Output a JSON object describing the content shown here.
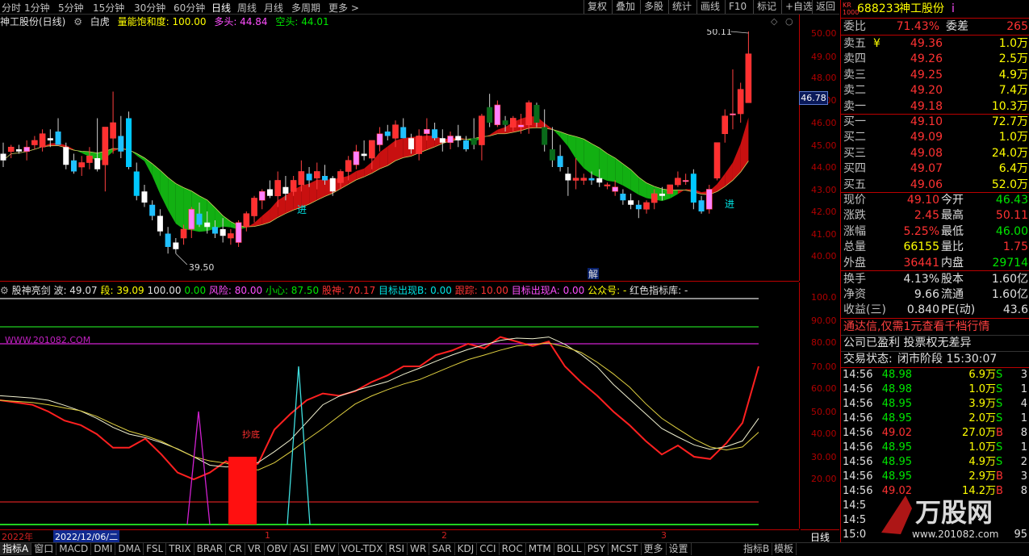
{
  "toolbar": {
    "periods": [
      "分时",
      "1分钟",
      "5分钟",
      "15分钟",
      "30分钟",
      "60分钟",
      "日线",
      "周线",
      "月线",
      "多周期",
      "更多 >"
    ],
    "active_period": "日线",
    "right_buttons": [
      "复权",
      "叠加",
      "多股",
      "统计",
      "画线",
      "F10",
      "标记",
      "+自选",
      "返回"
    ]
  },
  "price_header": {
    "name": "神工股份(日线)",
    "indicator": "白虎",
    "saturation_label": "量能饱和度: 100.00",
    "long_label": "多头: 44.84",
    "short_label": "空头: 44.01"
  },
  "price_axis": {
    "labels": [
      "50.00",
      "49.00",
      "48.00",
      "47.00",
      "46.00",
      "45.00",
      "44.00",
      "43.00",
      "42.00",
      "41.00",
      "40.00"
    ],
    "current": "46.78",
    "high_mark": "50.11",
    "low_mark": "39.50",
    "buy_marks": [
      "进",
      "进"
    ]
  },
  "indicator_header": {
    "name": "股神亮剑",
    "values": [
      "波: 49.07",
      "段: 39.09",
      "100.00",
      "0.00",
      "风险: 80.00",
      "小心: 87.50",
      "股神: 70.17",
      "目标出现B: 0.00",
      "跟踪: 10.00",
      "目标出现A: 0.00",
      "公众号: -",
      "红色指标库: -"
    ],
    "watermark": "WWW.201082.COM",
    "bottom_label": "抄底",
    "solve_label": "解"
  },
  "ind_axis": {
    "labels": [
      "100.0",
      "90.00",
      "80.00",
      "70.00",
      "60.00",
      "50.00",
      "40.00",
      "30.00",
      "20.00"
    ]
  },
  "date_bar": {
    "year": "2022年",
    "selected_date": "2022/12/06/二",
    "months": [
      "1",
      "2",
      "3"
    ]
  },
  "bottom_tabs": {
    "items": [
      "指标A",
      "窗口",
      "MACD",
      "DMI",
      "DMA",
      "FSL",
      "TRIX",
      "BRAR",
      "CR",
      "VR",
      "OBV",
      "ASI",
      "EMV",
      "VOL-TDX",
      "RSI",
      "WR",
      "SAR",
      "KDJ",
      "CCI",
      "ROC",
      "MTM",
      "BOLL",
      "PSY",
      "MCST",
      "更多",
      "设置"
    ],
    "right_items": [
      "指标B",
      "模板"
    ],
    "period_btn": "日线"
  },
  "quote": {
    "tag": "KR 1000",
    "code": "688233",
    "name": "神工股份",
    "info_icon": "i",
    "weibi_label": "委比",
    "weibi": "71.43%",
    "weicha_label": "委差",
    "weicha": "265",
    "asks": [
      {
        "label": "卖五",
        "price": "49.36",
        "vol": "1.0万",
        "flag": "¥"
      },
      {
        "label": "卖四",
        "price": "49.26",
        "vol": "2.5万"
      },
      {
        "label": "卖三",
        "price": "49.25",
        "vol": "4.9万"
      },
      {
        "label": "卖二",
        "price": "49.20",
        "vol": "7.4万"
      },
      {
        "label": "卖一",
        "price": "49.18",
        "vol": "10.3万"
      }
    ],
    "bids": [
      {
        "label": "买一",
        "price": "49.10",
        "vol": "72.7万"
      },
      {
        "label": "买二",
        "price": "49.09",
        "vol": "1.0万"
      },
      {
        "label": "买三",
        "price": "49.08",
        "vol": "24.0万"
      },
      {
        "label": "买四",
        "price": "49.07",
        "vol": "6.4万"
      },
      {
        "label": "买五",
        "price": "49.06",
        "vol": "52.0万"
      }
    ],
    "stats": [
      {
        "l1": "现价",
        "v1": "49.10",
        "c1": "red",
        "l2": "今开",
        "v2": "46.43",
        "c2": "green"
      },
      {
        "l1": "涨跌",
        "v1": "2.45",
        "c1": "red",
        "l2": "最高",
        "v2": "50.11",
        "c2": "red"
      },
      {
        "l1": "涨幅",
        "v1": "5.25%",
        "c1": "red",
        "l2": "最低",
        "v2": "46.00",
        "c2": "green"
      },
      {
        "l1": "总量",
        "v1": "66155",
        "c1": "yellow",
        "l2": "量比",
        "v2": "1.75",
        "c2": "red"
      },
      {
        "l1": "外盘",
        "v1": "36441",
        "c1": "red",
        "l2": "内盘",
        "v2": "29714",
        "c2": "green"
      }
    ],
    "fund": [
      {
        "l1": "换手",
        "v1": "4.13%",
        "l2": "股本",
        "v2": "1.60亿"
      },
      {
        "l1": "净资",
        "v1": "9.66",
        "l2": "流通",
        "v2": "1.60亿"
      },
      {
        "l1": "收益(三)",
        "v1": "0.840",
        "l2": "PE(动)",
        "v2": "43.6"
      }
    ],
    "promo": "通达信,仅需1元查看千档行情",
    "notice": "公司已盈利 投票权无差异",
    "trade_state_label": "交易状态:",
    "trade_state": "闭市阶段 15:30:07"
  },
  "ticks": [
    {
      "t": "14:56",
      "p": "48.98",
      "v": "6.9万",
      "s": "S",
      "n": "3"
    },
    {
      "t": "14:56",
      "p": "48.98",
      "v": "1.0万",
      "s": "S",
      "n": "1"
    },
    {
      "t": "14:56",
      "p": "48.95",
      "v": "3.9万",
      "s": "S",
      "n": "4"
    },
    {
      "t": "14:56",
      "p": "48.95",
      "v": "2.0万",
      "s": "S",
      "n": "1"
    },
    {
      "t": "14:56",
      "p": "49.02",
      "v": "27.0万",
      "s": "B",
      "n": "8"
    },
    {
      "t": "14:56",
      "p": "48.95",
      "v": "1.0万",
      "s": "S",
      "n": "1"
    },
    {
      "t": "14:56",
      "p": "48.95",
      "v": "4.9万",
      "s": "S",
      "n": "2"
    },
    {
      "t": "14:56",
      "p": "48.95",
      "v": "2.9万",
      "s": "B",
      "n": "3"
    },
    {
      "t": "14:56",
      "p": "49.02",
      "v": "14.2万",
      "s": "B",
      "n": "8"
    },
    {
      "t": "14:5",
      "p": "",
      "v": "",
      "s": "",
      "n": ""
    },
    {
      "t": "14:5",
      "p": "",
      "v": "",
      "s": "",
      "n": ""
    },
    {
      "t": "15:0",
      "p": "",
      "v": "",
      "s": "",
      "n": "95"
    }
  ],
  "watermark": {
    "title": "万股网",
    "url": "www.201082.com"
  },
  "chart_data": {
    "type": "candlestick",
    "ylim": [
      39.5,
      50.5
    ],
    "candles": [
      [
        44.6,
        45.1,
        44.0,
        44.3
      ],
      [
        44.7,
        45.0,
        44.4,
        44.9
      ],
      [
        44.8,
        45.0,
        44.6,
        44.7
      ],
      [
        44.7,
        45.2,
        44.3,
        44.9
      ],
      [
        45.0,
        45.4,
        44.8,
        45.2
      ],
      [
        44.9,
        45.7,
        44.7,
        45.5
      ],
      [
        45.3,
        45.7,
        44.9,
        45.2
      ],
      [
        45.6,
        46.2,
        45.0,
        45.0
      ],
      [
        44.9,
        45.1,
        43.9,
        44.1
      ],
      [
        44.3,
        44.6,
        43.7,
        43.8
      ],
      [
        44.0,
        44.5,
        43.6,
        44.2
      ],
      [
        44.2,
        44.9,
        43.9,
        44.5
      ],
      [
        44.4,
        46.2,
        43.8,
        43.9
      ],
      [
        44.1,
        45.8,
        42.9,
        45.8
      ],
      [
        45.3,
        47.4,
        44.6,
        46.0
      ],
      [
        45.4,
        46.3,
        44.4,
        44.7
      ],
      [
        46.2,
        46.5,
        43.9,
        44.0
      ],
      [
        43.8,
        44.2,
        42.5,
        42.7
      ],
      [
        42.9,
        43.2,
        42.2,
        42.4
      ],
      [
        42.3,
        42.5,
        41.6,
        41.8
      ],
      [
        41.8,
        42.1,
        40.9,
        41.1
      ],
      [
        41.0,
        41.3,
        40.1,
        40.4
      ],
      [
        40.6,
        40.8,
        40.1,
        40.3
      ],
      [
        40.8,
        41.4,
        40.5,
        41.2
      ],
      [
        41.2,
        42.2,
        40.8,
        42.1
      ],
      [
        41.9,
        42.4,
        41.3,
        41.4
      ],
      [
        41.5,
        42.0,
        41.0,
        41.3
      ],
      [
        41.3,
        41.6,
        40.8,
        41.0
      ],
      [
        41.2,
        41.7,
        40.6,
        40.9
      ],
      [
        40.8,
        41.2,
        40.5,
        41.0
      ],
      [
        40.6,
        41.6,
        40.4,
        41.5
      ],
      [
        41.3,
        42.0,
        41.1,
        41.9
      ],
      [
        41.8,
        42.7,
        41.5,
        42.6
      ],
      [
        42.5,
        43.0,
        42.1,
        42.9
      ],
      [
        43.0,
        43.4,
        42.6,
        42.7
      ],
      [
        42.7,
        43.8,
        42.2,
        43.4
      ],
      [
        43.1,
        43.6,
        42.5,
        42.8
      ],
      [
        42.9,
        43.6,
        42.7,
        43.4
      ],
      [
        43.2,
        44.3,
        42.9,
        43.8
      ],
      [
        43.7,
        44.0,
        43.1,
        43.4
      ],
      [
        43.5,
        44.2,
        43.0,
        43.8
      ],
      [
        43.6,
        44.1,
        43.2,
        43.4
      ],
      [
        43.5,
        43.6,
        42.7,
        42.9
      ],
      [
        43.3,
        43.9,
        43.0,
        43.8
      ],
      [
        43.8,
        44.5,
        43.4,
        44.3
      ],
      [
        44.1,
        45.0,
        43.9,
        44.7
      ],
      [
        44.6,
        45.2,
        44.3,
        44.5
      ],
      [
        44.4,
        45.2,
        43.9,
        45.2
      ],
      [
        45.0,
        45.8,
        44.7,
        45.5
      ],
      [
        45.6,
        45.9,
        45.2,
        45.4
      ],
      [
        45.3,
        46.1,
        44.9,
        45.9
      ],
      [
        45.8,
        46.2,
        45.3,
        45.3
      ],
      [
        45.3,
        45.5,
        44.6,
        44.8
      ],
      [
        44.6,
        45.7,
        44.3,
        45.4
      ],
      [
        45.5,
        46.2,
        45.2,
        45.7
      ],
      [
        45.7,
        46.0,
        45.2,
        45.3
      ],
      [
        45.3,
        45.7,
        44.7,
        45.1
      ],
      [
        45.1,
        45.6,
        44.8,
        45.4
      ],
      [
        45.4,
        45.9,
        44.9,
        45.2
      ],
      [
        45.2,
        45.4,
        44.7,
        44.8
      ],
      [
        45.3,
        46.2,
        44.8,
        45.0
      ],
      [
        45.0,
        46.4,
        44.3,
        46.3
      ],
      [
        46.7,
        47.3,
        45.8,
        46.0
      ],
      [
        45.9,
        47.0,
        45.8,
        46.8
      ],
      [
        46.1,
        46.3,
        45.6,
        45.9
      ],
      [
        45.8,
        46.3,
        45.6,
        46.2
      ],
      [
        45.8,
        46.4,
        45.5,
        45.9
      ],
      [
        45.9,
        47.0,
        45.5,
        46.9
      ],
      [
        46.8,
        46.9,
        45.8,
        46.0
      ],
      [
        45.8,
        46.6,
        44.7,
        45.0
      ],
      [
        44.8,
        45.8,
        44.0,
        44.3
      ],
      [
        44.5,
        45.0,
        43.8,
        44.0
      ],
      [
        43.7,
        44.0,
        42.7,
        43.4
      ],
      [
        43.4,
        44.4,
        43.0,
        43.5
      ],
      [
        43.4,
        43.7,
        43.2,
        43.5
      ],
      [
        43.5,
        43.8,
        43.2,
        43.4
      ],
      [
        43.5,
        43.9,
        43.1,
        43.3
      ],
      [
        43.2,
        43.3,
        43.0,
        43.2
      ],
      [
        42.9,
        43.4,
        42.7,
        43.1
      ],
      [
        42.8,
        43.0,
        42.3,
        42.5
      ],
      [
        42.5,
        42.8,
        42.1,
        42.3
      ],
      [
        42.3,
        42.5,
        41.7,
        42.1
      ],
      [
        42.1,
        42.5,
        41.9,
        42.4
      ],
      [
        42.4,
        43.0,
        42.1,
        42.8
      ],
      [
        42.8,
        43.1,
        42.5,
        42.7
      ],
      [
        42.8,
        43.2,
        42.8,
        43.2
      ],
      [
        43.2,
        43.8,
        43.1,
        43.5
      ],
      [
        43.4,
        43.7,
        43.2,
        43.4
      ],
      [
        43.7,
        43.9,
        42.1,
        42.4
      ],
      [
        42.5,
        42.7,
        41.9,
        42.0
      ],
      [
        42.1,
        43.2,
        41.9,
        43.0
      ],
      [
        43.5,
        45.1,
        43.4,
        45.1
      ],
      [
        45.5,
        46.6,
        45.1,
        46.3
      ],
      [
        46.4,
        48.4,
        45.7,
        46.4
      ],
      [
        46.4,
        47.8,
        46.0,
        47.5
      ],
      [
        46.9,
        50.11,
        46.9,
        49.1
      ]
    ]
  }
}
